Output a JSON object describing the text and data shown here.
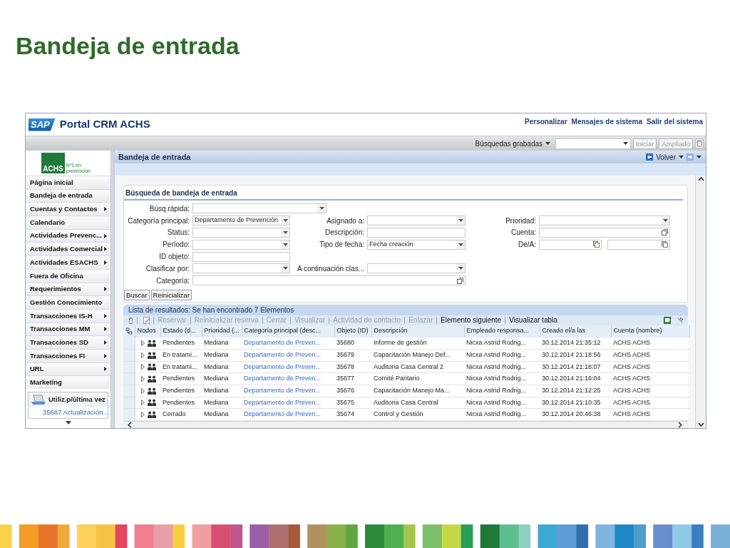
{
  "slide_title": "Bandeja de entrada",
  "header": {
    "logo_text": "SAP",
    "title": "Portal CRM ACHS",
    "links": [
      "Personalizar",
      "Mensajes de sistema",
      "Salir del sistema"
    ]
  },
  "saved_search_bar": {
    "label": "Búsquedas grabadas",
    "buttons": [
      {
        "label": "Iniciar",
        "disabled": true
      },
      {
        "label": "Ampliado",
        "disabled": true
      }
    ]
  },
  "sidebar": {
    "logo": {
      "name": "ACHS",
      "tagline": "Nº1 en prevención"
    },
    "items": [
      {
        "label": "Página inicial",
        "submenu": false
      },
      {
        "label": "Bandeja de entrada",
        "submenu": false
      },
      {
        "label": "Cuentas y Contactos",
        "submenu": true
      },
      {
        "label": "Calendario",
        "submenu": false
      },
      {
        "label": "Actividades Prevenc...",
        "submenu": true
      },
      {
        "label": "Actividades Comercial",
        "submenu": true
      },
      {
        "label": "Actividades ESACHS",
        "submenu": true
      },
      {
        "label": "Fuera de Oficina",
        "submenu": false
      },
      {
        "label": "Requerimientos",
        "submenu": true
      },
      {
        "label": "Gestión Conocimiento",
        "submenu": false
      },
      {
        "label": "Transacciones IS-H",
        "submenu": true
      },
      {
        "label": "Transacciones MM",
        "submenu": true
      },
      {
        "label": "Transacciones SD",
        "submenu": true
      },
      {
        "label": "Transacciones FI",
        "submenu": true
      },
      {
        "label": "URL",
        "submenu": true
      },
      {
        "label": "Marketing",
        "submenu": false
      }
    ],
    "recent": {
      "title": "Utiliz.p/última vez",
      "items": [
        "35687 Actualización..."
      ]
    }
  },
  "page": {
    "title": "Bandeja de entrada",
    "back_label": "Volver"
  },
  "search": {
    "title": "Búsqueda de bandeja de entrada",
    "rows": [
      [
        {
          "label": "Búsq.rápida:",
          "kind": "wide-dropdown"
        },
        null,
        null
      ],
      [
        {
          "label": "Categoría principal:",
          "kind": "dropdown",
          "value": "Departamento de Prevención"
        },
        {
          "label": "Asignado a:",
          "kind": "dropdown"
        },
        {
          "label": "Prioridad:",
          "kind": "dropdown"
        }
      ],
      [
        {
          "label": "Status:",
          "kind": "dropdown"
        },
        {
          "label": "Descripción:",
          "kind": "text"
        },
        {
          "label": "Cuenta:",
          "kind": "lookup"
        }
      ],
      [
        {
          "label": "Período:",
          "kind": "dropdown"
        },
        {
          "label": "Tipo de fecha:",
          "kind": "dropdown",
          "value": "Fecha creación"
        },
        {
          "label": "De/A:",
          "kind": "daterange"
        }
      ],
      [
        {
          "label": "ID objeto:",
          "kind": "text"
        },
        null,
        null
      ],
      [
        {
          "label": "Clasificar por:",
          "kind": "dropdown"
        },
        {
          "label": "A continuación clas...",
          "kind": "dropdown"
        },
        null
      ],
      [
        {
          "label": "Categoría:",
          "kind": "wide-lookup"
        },
        null,
        null
      ]
    ],
    "buttons": [
      "Buscar",
      "Reinicializar"
    ]
  },
  "results": {
    "title": "Lista de resultados: Se han encontrado 7 Elementos",
    "toolbar": [
      {
        "label": "Reservar",
        "disabled": true
      },
      {
        "label": "Reinicializar reserva",
        "disabled": true
      },
      {
        "label": "Cerrar",
        "disabled": true
      },
      {
        "label": "Visualizar",
        "disabled": true
      },
      {
        "label": "Actividad de contacto",
        "disabled": true
      },
      {
        "label": "Enlazar",
        "disabled": true
      },
      {
        "label": "Elemento siguiente",
        "disabled": false
      },
      {
        "label": "Visualizar tabla",
        "disabled": false
      }
    ],
    "columns": [
      "Nodos",
      "Estado (d...",
      "Prioridad (...",
      "Categoría principal (desc...",
      "Objeto (ID)",
      "Descripción",
      "Empleado responsa...",
      "Creado el/a las",
      "Cuenta (nombre)"
    ],
    "rows": [
      [
        "",
        "Pendientes",
        "Mediana",
        "Departamento de Preven...",
        "35680",
        "Informe de gestión",
        "Nicxa Astrid Rodrig...",
        "30.12.2014 21:35:12",
        "ACHS ACHS"
      ],
      [
        "",
        "En tratami...",
        "Mediana",
        "Departamento de Preven...",
        "35679",
        "Capacitación Manejo Def...",
        "Nicxa Astrid Rodrig...",
        "30.12.2014 21:18:56",
        "ACHS ACHS"
      ],
      [
        "",
        "En tratami...",
        "Mediana",
        "Departamento de Preven...",
        "35678",
        "Auditoria Casa Central 2",
        "Nicxa Astrid Rodrig...",
        "30.12.2014 21:18:07",
        "ACHS ACHS"
      ],
      [
        "",
        "Pendientes",
        "Mediana",
        "Departamento de Preven...",
        "35677",
        "Comité Paritario",
        "Nicxa Astrid Rodrig...",
        "30.12.2014 21:16:04",
        "ACHS ACHS"
      ],
      [
        "",
        "Pendientes",
        "Mediana",
        "Departamento de Preven...",
        "35676",
        "Capacitación Manejo Ma...",
        "Nicxa Astrid Rodrig...",
        "30.12.2014 21:12:25",
        "ACHS ACHS"
      ],
      [
        "",
        "Pendientes",
        "Mediana",
        "Departamento de Preven...",
        "35675",
        "Auditoria Casa Central",
        "Nicxa Astrid Rodrig...",
        "30.12.2014 21:10:35",
        "ACHS ACHS"
      ],
      [
        "",
        "Cerrado",
        "Mediana",
        "Departamento de Preven...",
        "35674",
        "Control y Gestión",
        "Nicxa Astrid Rodrig...",
        "30.12.2014 20:46:38",
        "ACHS ACHS"
      ]
    ]
  }
}
